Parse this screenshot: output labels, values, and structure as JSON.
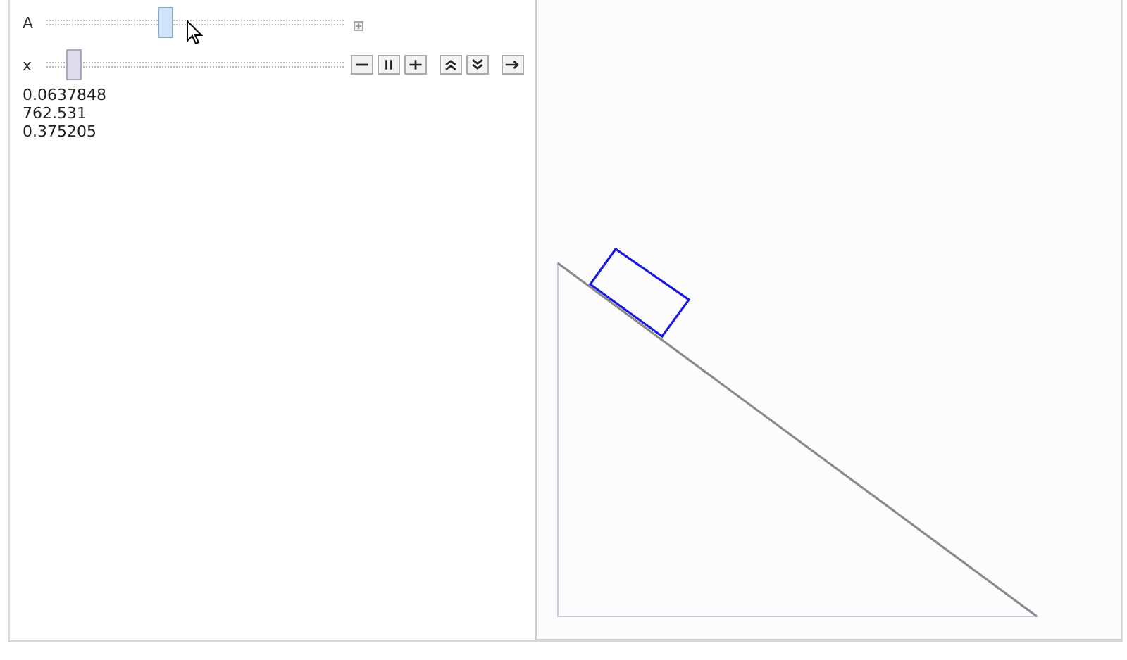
{
  "controls": {
    "sliders": [
      {
        "label": "A",
        "kind": "plain",
        "level": 0.4
      },
      {
        "label": "x",
        "kind": "animated",
        "level": 0.09
      }
    ]
  },
  "readouts": [
    "0.0637848",
    "762.531",
    "0.375205"
  ]
}
